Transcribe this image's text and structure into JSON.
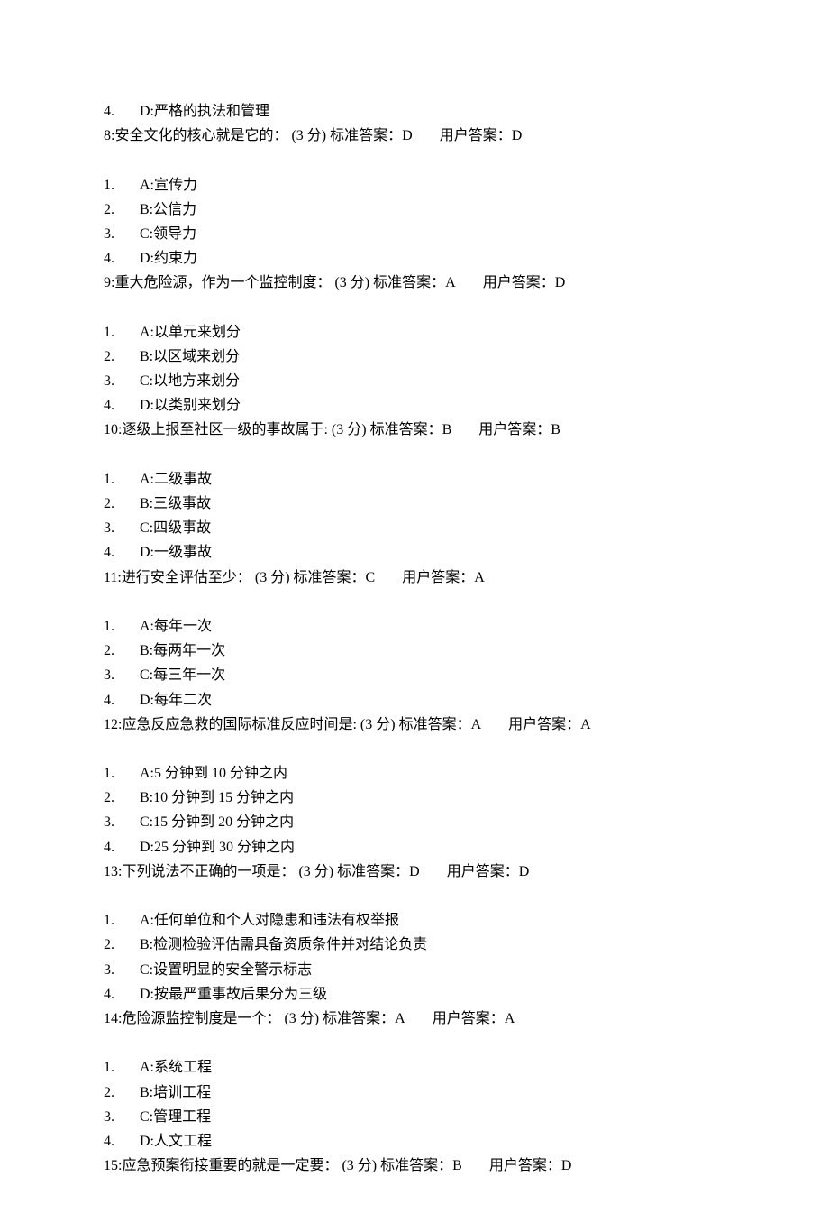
{
  "trailingOption": {
    "num": "4.",
    "text": "D:严格的执法和管理"
  },
  "questions": [
    {
      "qnum": "8",
      "stem": ":安全文化的核心就是它的：",
      "points": "(3 分)",
      "stdLabel": "标准答案：",
      "std": "D",
      "userLabel": "用户答案：",
      "user": "D",
      "options": [
        {
          "num": "1.",
          "text": "A:宣传力"
        },
        {
          "num": "2.",
          "text": "B:公信力"
        },
        {
          "num": "3.",
          "text": "C:领导力"
        },
        {
          "num": "4.",
          "text": "D:约束力"
        }
      ]
    },
    {
      "qnum": "9",
      "stem": ":重大危险源，作为一个监控制度：",
      "points": "(3 分)",
      "stdLabel": "标准答案：",
      "std": "A",
      "userLabel": "用户答案：",
      "user": "D",
      "options": [
        {
          "num": "1.",
          "text": "A:以单元来划分"
        },
        {
          "num": "2.",
          "text": "B:以区域来划分"
        },
        {
          "num": "3.",
          "text": "C:以地方来划分"
        },
        {
          "num": "4.",
          "text": "D:以类别来划分"
        }
      ]
    },
    {
      "qnum": "10",
      "stem": ":逐级上报至社区一级的事故属于:",
      "points": "(3 分)",
      "stdLabel": "标准答案：",
      "std": "B",
      "userLabel": "用户答案：",
      "user": "B",
      "options": [
        {
          "num": "1.",
          "text": "A:二级事故"
        },
        {
          "num": "2.",
          "text": "B:三级事故"
        },
        {
          "num": "3.",
          "text": "C:四级事故"
        },
        {
          "num": "4.",
          "text": "D:一级事故"
        }
      ]
    },
    {
      "qnum": "11",
      "stem": ":进行安全评估至少：",
      "points": "(3 分)",
      "stdLabel": "标准答案：",
      "std": "C",
      "userLabel": "用户答案：",
      "user": "A",
      "options": [
        {
          "num": "1.",
          "text": "A:每年一次"
        },
        {
          "num": "2.",
          "text": "B:每两年一次"
        },
        {
          "num": "3.",
          "text": "C:每三年一次"
        },
        {
          "num": "4.",
          "text": "D:每年二次"
        }
      ]
    },
    {
      "qnum": "12",
      "stem": ":应急反应急救的国际标准反应时间是:",
      "points": "(3 分)",
      "stdLabel": "标准答案：",
      "std": "A",
      "userLabel": "用户答案：",
      "user": "A",
      "options": [
        {
          "num": "1.",
          "text": "A:5 分钟到 10 分钟之内"
        },
        {
          "num": "2.",
          "text": "B:10 分钟到 15 分钟之内"
        },
        {
          "num": "3.",
          "text": "C:15 分钟到 20 分钟之内"
        },
        {
          "num": "4.",
          "text": "D:25 分钟到 30 分钟之内"
        }
      ]
    },
    {
      "qnum": "13",
      "stem": ":下列说法不正确的一项是：",
      "points": "(3 分)",
      "stdLabel": "标准答案：",
      "std": "D",
      "userLabel": "用户答案：",
      "user": "D",
      "options": [
        {
          "num": "1.",
          "text": "A:任何单位和个人对隐患和违法有权举报"
        },
        {
          "num": "2.",
          "text": "B:检测检验评估需具备资质条件并对结论负责"
        },
        {
          "num": "3.",
          "text": "C:设置明显的安全警示标志"
        },
        {
          "num": "4.",
          "text": "D:按最严重事故后果分为三级"
        }
      ]
    },
    {
      "qnum": "14",
      "stem": ":危险源监控制度是一个：",
      "points": "(3 分)",
      "stdLabel": "标准答案：",
      "std": "A",
      "userLabel": "用户答案：",
      "user": "A",
      "options": [
        {
          "num": "1.",
          "text": "A:系统工程"
        },
        {
          "num": "2.",
          "text": "B:培训工程"
        },
        {
          "num": "3.",
          "text": "C:管理工程"
        },
        {
          "num": "4.",
          "text": "D:人文工程"
        }
      ]
    },
    {
      "qnum": "15",
      "stem": ":应急预案衔接重要的就是一定要：",
      "points": "(3 分)",
      "stdLabel": "标准答案：",
      "std": "B",
      "userLabel": "用户答案：",
      "user": "D",
      "options": []
    }
  ]
}
